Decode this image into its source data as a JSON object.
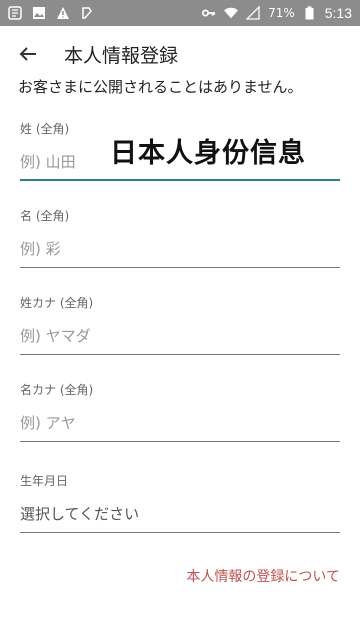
{
  "status": {
    "battery": "71%",
    "time": "5:13"
  },
  "header": {
    "title": "本人情報登録"
  },
  "notice": "お客さまに公開されることはありません。",
  "overlay_caption": "日本人身份信息",
  "fields": [
    {
      "label": "姓 (全角)",
      "placeholder": "例) 山田"
    },
    {
      "label": "名 (全角)",
      "placeholder": "例) 彩"
    },
    {
      "label": "姓カナ (全角)",
      "placeholder": "例) ヤマダ"
    },
    {
      "label": "名カナ (全角)",
      "placeholder": "例) アヤ"
    },
    {
      "label": "生年月日",
      "placeholder": "選択してください"
    }
  ],
  "footer_link": "本人情報の登録について"
}
